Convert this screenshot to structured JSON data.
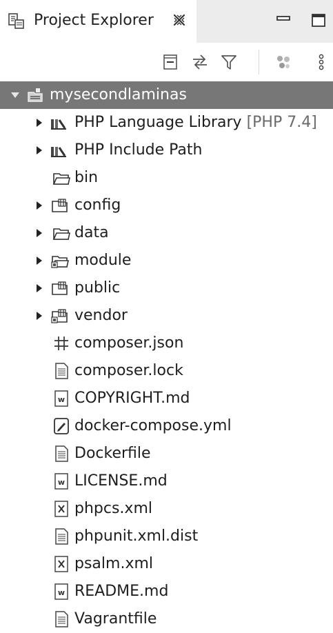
{
  "view": {
    "title": "Project Explorer",
    "tab_icon": "project-explorer-icon",
    "close_icon": "close-icon",
    "minimize_icon": "minimize-icon",
    "maximize_icon": "maximize-icon"
  },
  "toolbar": {
    "buttons": [
      {
        "name": "collapse-all-button",
        "icon": "collapse-all-icon"
      },
      {
        "name": "link-with-editor-button",
        "icon": "link-with-editor-icon"
      },
      {
        "name": "filter-button",
        "icon": "filter-icon"
      },
      {
        "name": "select-working-set-button",
        "icon": "working-set-icon"
      },
      {
        "name": "view-menu-button",
        "icon": "view-menu-icon"
      }
    ]
  },
  "tree": {
    "project": {
      "label": "mysecondlaminas",
      "icon": "php-project-icon",
      "expanded": true,
      "selected": true
    },
    "items": [
      {
        "label": "PHP Language Library",
        "decoration": "[PHP 7.4]",
        "icon": "library-icon",
        "expandable": true
      },
      {
        "label": "PHP Include Path",
        "decoration": "",
        "icon": "library-icon",
        "expandable": true
      },
      {
        "label": "bin",
        "decoration": "",
        "icon": "folder-icon",
        "expandable": false
      },
      {
        "label": "config",
        "decoration": "",
        "icon": "package-folder-icon",
        "expandable": true
      },
      {
        "label": "data",
        "decoration": "",
        "icon": "folder-icon",
        "expandable": true
      },
      {
        "label": "module",
        "decoration": "",
        "icon": "source-folder-icon",
        "expandable": true
      },
      {
        "label": "public",
        "decoration": "",
        "icon": "package-folder-icon",
        "expandable": true
      },
      {
        "label": "vendor",
        "decoration": "",
        "icon": "source-package-folder-icon",
        "expandable": true
      },
      {
        "label": "composer.json",
        "decoration": "",
        "icon": "json-file-icon",
        "expandable": false
      },
      {
        "label": "composer.lock",
        "decoration": "",
        "icon": "text-file-icon",
        "expandable": false
      },
      {
        "label": "COPYRIGHT.md",
        "decoration": "",
        "icon": "markdown-file-icon",
        "expandable": false
      },
      {
        "label": "docker-compose.yml",
        "decoration": "",
        "icon": "yaml-file-icon",
        "expandable": false
      },
      {
        "label": "Dockerfile",
        "decoration": "",
        "icon": "text-file-icon",
        "expandable": false
      },
      {
        "label": "LICENSE.md",
        "decoration": "",
        "icon": "markdown-file-icon",
        "expandable": false
      },
      {
        "label": "phpcs.xml",
        "decoration": "",
        "icon": "xml-file-icon",
        "expandable": false
      },
      {
        "label": "phpunit.xml.dist",
        "decoration": "",
        "icon": "text-file-icon",
        "expandable": false
      },
      {
        "label": "psalm.xml",
        "decoration": "",
        "icon": "xml-file-icon",
        "expandable": false
      },
      {
        "label": "README.md",
        "decoration": "",
        "icon": "markdown-file-icon",
        "expandable": false
      },
      {
        "label": "Vagrantfile",
        "decoration": "",
        "icon": "text-file-icon",
        "expandable": false
      }
    ]
  },
  "colors": {
    "selection": "#777777",
    "decoration": "#6a6a6a",
    "tab_bar": "#ececec"
  }
}
